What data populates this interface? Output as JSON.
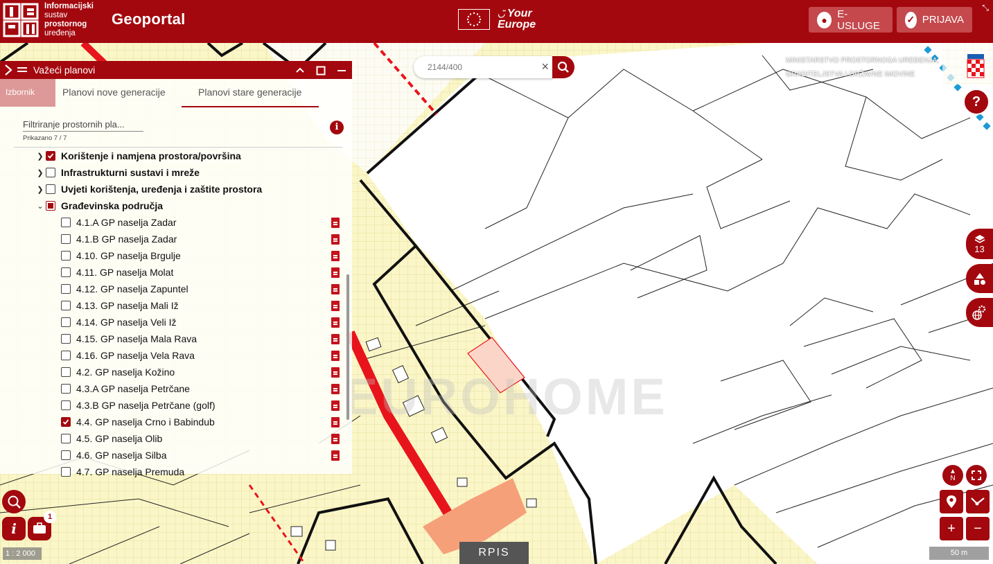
{
  "header": {
    "org_line1": "Informacijski",
    "org_line2": "sustav",
    "org_line3": "prostornog",
    "org_line4": "uređenja",
    "app_title": "Geoportal",
    "your_europe_line1": "Your",
    "your_europe_line2": "Europe",
    "e_services_label": "E-USLUGE",
    "login_label": "PRIJAVA"
  },
  "search": {
    "value": "2144/400",
    "clear_symbol": "×"
  },
  "ministry": {
    "line1": "MINISTARSTVO PROSTORNOGA UREĐENJA,",
    "line2": "GRADITELJSTVA I DRŽAVNE IMOVINE"
  },
  "panel": {
    "title": "Važeći planovi",
    "ghost_tab": "Izbornik",
    "tabs": [
      "Planovi nove generacije",
      "Planovi stare generacije"
    ],
    "active_tab": 1,
    "filter_placeholder": "Filtriranje prostornih pla...",
    "shown_count": "Prikazano 7 / 7",
    "groups": [
      {
        "label": "Korištenje i namjena prostora/površina",
        "state": "checked"
      },
      {
        "label": "Infrastrukturni sustavi i mreže",
        "state": "unchecked"
      },
      {
        "label": "Uvjeti korištenja, uređenja i zaštite prostora",
        "state": "unchecked"
      },
      {
        "label": "Građevinska područja",
        "state": "partial"
      }
    ],
    "items": [
      {
        "label": "4.1.A GP naselja Zadar",
        "checked": false
      },
      {
        "label": "4.1.B GP naselja Zadar",
        "checked": false
      },
      {
        "label": "4.10. GP naselja Brgulje",
        "checked": false
      },
      {
        "label": "4.11. GP naselja Molat",
        "checked": false
      },
      {
        "label": "4.12. GP naselja Zapuntel",
        "checked": false
      },
      {
        "label": "4.13. GP naselja Mali Iž",
        "checked": false
      },
      {
        "label": "4.14. GP naselja Veli Iž",
        "checked": false
      },
      {
        "label": "4.15. GP naselja Mala Rava",
        "checked": false
      },
      {
        "label": "4.16. GP naselja Vela Rava",
        "checked": false
      },
      {
        "label": "4.2. GP naselja Kožino",
        "checked": false
      },
      {
        "label": "4.3.A GP naselja Petrčane",
        "checked": false
      },
      {
        "label": "4.3.B GP naselja Petrčane (golf)",
        "checked": false
      },
      {
        "label": "4.4. GP naselja Crno i Babindub",
        "checked": true
      },
      {
        "label": "4.5. GP naselja Olib",
        "checked": false
      },
      {
        "label": "4.6. GP naselja Silba",
        "checked": false
      },
      {
        "label": "4.7. GP naselja Premuda",
        "checked": false
      }
    ]
  },
  "map_controls": {
    "layers_count": "13",
    "north_label": "N",
    "zoom_in": "+",
    "zoom_out": "−",
    "notification_count": "1",
    "scale_ratio": "1 : 2 000",
    "scale_bar": "50 m",
    "rpis_logo": "RPIS",
    "watermark": "EUROHOME"
  },
  "colors": {
    "brand_red": "#a3080e",
    "map_yellow": "#fbf6c8",
    "road_red": "#e8141c",
    "salmon": "#f5a079"
  }
}
